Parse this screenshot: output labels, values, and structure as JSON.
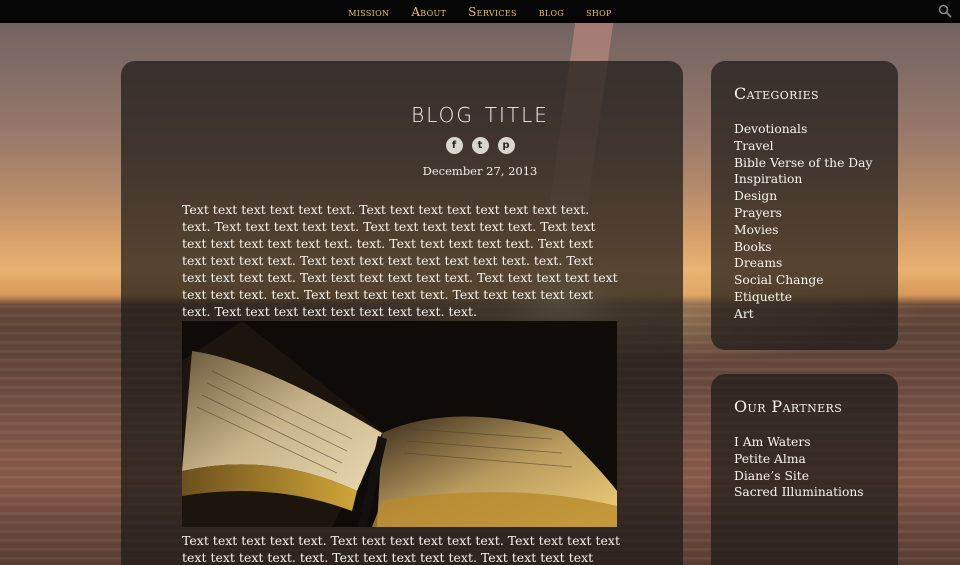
{
  "nav": {
    "items": [
      "mission",
      "About",
      "Services",
      "blog",
      "shop"
    ]
  },
  "post": {
    "title": "blog title",
    "date": "December 27, 2013",
    "paragraph_1": "Text text text text text text. Text text text text text text text text. text. Text text text text text. Text text text text text text. Text text text text text text text text. text. Text text text text text. Text text text text text text. Text text text text text text text text. text. Text text text text text. Text text text text text text. Text text text text text text text text. text. Text text text text text. Text text text text text text. Text text text text text text text text. text.",
    "paragraph_2": "Text text text text text. Text text text text text text. Text text text text text text text text. text. Text text text text text. Text text text text text text. Text",
    "social": {
      "facebook": "f",
      "twitter": "t",
      "pinterest": "p"
    }
  },
  "sidebar": {
    "categories": {
      "heading": "Categories",
      "items": [
        "Devotionals",
        "Travel",
        "Bible Verse of the Day",
        "Inspiration",
        "Design",
        "Prayers",
        "Movies",
        "Books",
        "Dreams",
        "Social Change",
        "Etiquette",
        "Art"
      ]
    },
    "partners": {
      "heading": "Our Partners",
      "items": [
        "I Am Waters",
        "Petite Alma",
        "Diane’s Site",
        "Sacred Illuminations"
      ]
    }
  },
  "colors": {
    "nav_text": "#f0c44c",
    "topbar_bg": "#050505",
    "panel_bg": "rgba(28,26,24,0.72)"
  }
}
